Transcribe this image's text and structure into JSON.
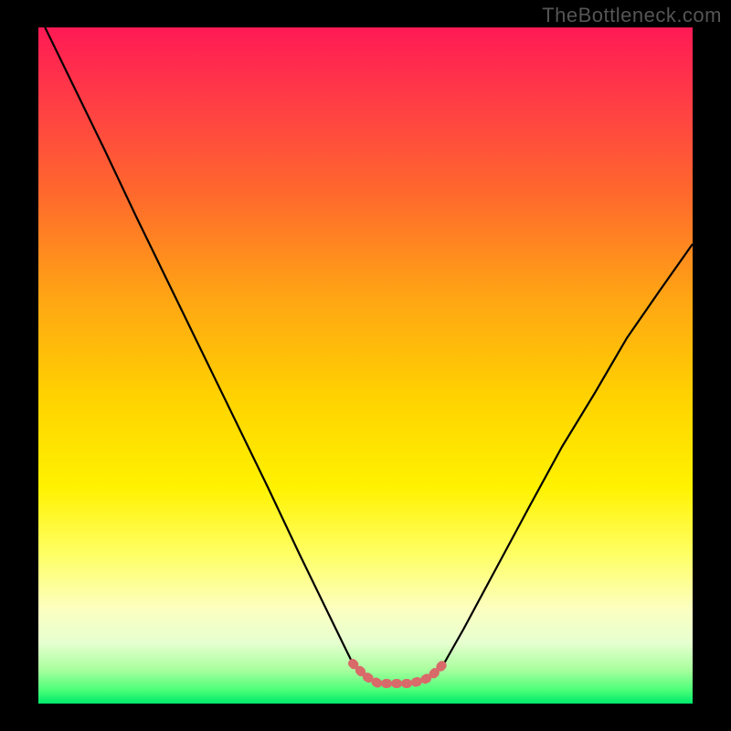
{
  "watermark": {
    "text": "TheBottleneck.com"
  },
  "chart_data": {
    "type": "line",
    "title": "",
    "xlabel": "",
    "ylabel": "",
    "xlim": [
      0,
      100
    ],
    "ylim": [
      0,
      100
    ],
    "series": [
      {
        "name": "bottleneck-curve",
        "x": [
          0,
          5,
          10,
          15,
          20,
          25,
          30,
          35,
          40,
          45,
          48,
          50,
          52,
          54,
          56,
          58,
          60,
          62,
          65,
          70,
          75,
          80,
          85,
          90,
          95,
          100
        ],
        "values": [
          102,
          92,
          82,
          72,
          62,
          52,
          42,
          32,
          22,
          12,
          6,
          4,
          3,
          3,
          3,
          3,
          4,
          6,
          11,
          20,
          29,
          38,
          46,
          54,
          61,
          68
        ]
      },
      {
        "name": "optimal-range-marker",
        "x": [
          48,
          49,
          50,
          51,
          52,
          53,
          54,
          55,
          56,
          57,
          58,
          59,
          60,
          61,
          62
        ],
        "values": [
          6,
          5,
          4,
          3.5,
          3,
          3,
          3,
          3,
          3,
          3,
          3.2,
          3.5,
          4,
          5,
          6
        ]
      }
    ],
    "gradient_stops": [
      {
        "pos": 0,
        "color": "#ff1a55"
      },
      {
        "pos": 25,
        "color": "#ff6a2c"
      },
      {
        "pos": 55,
        "color": "#ffd300"
      },
      {
        "pos": 78,
        "color": "#ffff66"
      },
      {
        "pos": 95,
        "color": "#a8ff9e"
      },
      {
        "pos": 100,
        "color": "#00e86b"
      }
    ],
    "marker_color": "#d96a6a"
  }
}
